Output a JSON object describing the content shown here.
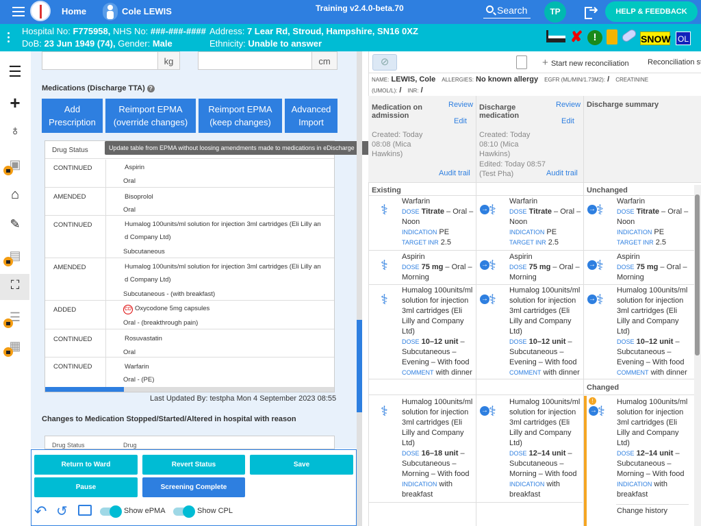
{
  "header": {
    "home_label": "Home",
    "patient_name": "Cole LEWIS",
    "training_label": "Training v2.4.0-beta.70",
    "search_label": "Search",
    "user_initials": "TP",
    "help_label": "HELP & FEEDBACK"
  },
  "patient_bar": {
    "hospital_no_label": "Hospital No:",
    "hospital_no": "F775958,",
    "nhs_label": "NHS No:",
    "nhs_no": "###-###-####",
    "address_label": "Address:",
    "address": "7 Lear Rd, Stroud, Hampshire, SN16 0XZ",
    "dob_label": "DoB:",
    "dob": "23 Jun 1949 (74),",
    "gender_label": "Gender:",
    "gender": "Male",
    "ethnicity_label": "Ethnicity:",
    "ethnicity": "Unable to answer",
    "snow_badge": "SNOW",
    "ol_badge": "OL"
  },
  "left": {
    "weight_unit": "kg",
    "height_unit": "cm",
    "section_title": "Medications (Discharge TTA)",
    "buttons": {
      "add": "Add Prescription",
      "reimport_override": "Reimport EPMA (override changes)",
      "reimport_keep": "Reimport EPMA (keep changes)",
      "advanced": "Advanced Import"
    },
    "tooltip": "Update table from EPMA without loosing amendments made to medications in eDischarge",
    "table_header": "Drug Status",
    "cd_badge": "CD",
    "rows": [
      {
        "status": "CONTINUED",
        "drug": "Aspirin",
        "route": "Oral"
      },
      {
        "status": "AMENDED",
        "drug": "Bisoprolol",
        "route": "Oral"
      },
      {
        "status": "CONTINUED",
        "drug": "Humalog 100units/ml solution for injection 3ml cartridges (Eli Lilly an",
        "drug2": "d Company Ltd)",
        "route": "Subcutaneous"
      },
      {
        "status": "AMENDED",
        "drug": "Humalog 100units/ml solution for injection 3ml cartridges (Eli Lilly an",
        "drug2": "d Company Ltd)",
        "route": "Subcutaneous - (with breakfast)"
      },
      {
        "status": "ADDED",
        "drug": "Oxycodone 5mg capsules",
        "route": "Oral - (breakthrough pain)"
      },
      {
        "status": "CONTINUED",
        "drug": "Rosuvastatin",
        "route": "Oral"
      },
      {
        "status": "CONTINUED",
        "drug": "Warfarin",
        "route": "Oral - (PE)"
      }
    ],
    "last_updated": "Last Updated By: testpha Mon 4 September 2023 08:55",
    "changes_title": "Changes to Medication Stopped/Started/Altered in hospital with reason",
    "changes_col1": "Drug Status",
    "changes_col2": "Drug"
  },
  "actions": {
    "return_ward": "Return to Ward",
    "revert": "Revert Status",
    "save": "Save",
    "pause": "Pause",
    "screening": "Screening Complete",
    "show_epma": "Show ePMA",
    "show_cpl": "Show CPL"
  },
  "right": {
    "start_reconciliation": "Start new reconciliation",
    "reconciliation_status": "Reconciliation st",
    "name_label": "NAME:",
    "name": "LEWIS, Cole",
    "allergies_label": "ALLERGIES:",
    "allergies": "No known allergy",
    "egfr_label": "EGFR (ML/MIN/1.73M2):",
    "egfr": "/",
    "creat_label": "CREATININE",
    "umol_label": "(UMOL/L):",
    "umol": "/",
    "inr_label": "INR:",
    "inr": "/",
    "col1_title": "Medication on admission",
    "col2_title": "Discharge medication",
    "col3_title": "Discharge summary",
    "review": "Review",
    "edit": "Edit",
    "col1_created": "Created: Today 08:08 (Mica Hawkins)",
    "col2_created": "Created: Today 08:10 (Mica Hawkins)",
    "col2_edited": "Edited: Today 08:57 (Test Pha)",
    "audit": "Audit trail",
    "existing": "Existing",
    "unchanged": "Unchanged",
    "changed": "Changed",
    "change_history": "Change history",
    "warfarin": "Warfarin",
    "dose_k": "DOSE",
    "titrate": "Titrate",
    "oral_noon": " – Oral – Noon",
    "indication_k": "INDICATION",
    "pe": "PE",
    "target_k": "TARGET INR",
    "inr_val": "2.5",
    "aspirin": "Aspirin",
    "dose75": "75 mg",
    "oral_morning": " – Oral – Morning",
    "humalog": "Humalog 100units/ml solution for injection 3ml cartridges (Eli Lilly and Company Ltd)",
    "dose1012": "10–12 unit",
    "evening": " – Subcutaneous – Evening – With food",
    "comment_k": "COMMENT",
    "with_dinner": "with dinner",
    "dose1618": "16–18 unit",
    "dose1214": "12–14 unit",
    "morning_food": " – Subcutaneous – Morning – With food",
    "with_breakfast": "with breakfast"
  }
}
